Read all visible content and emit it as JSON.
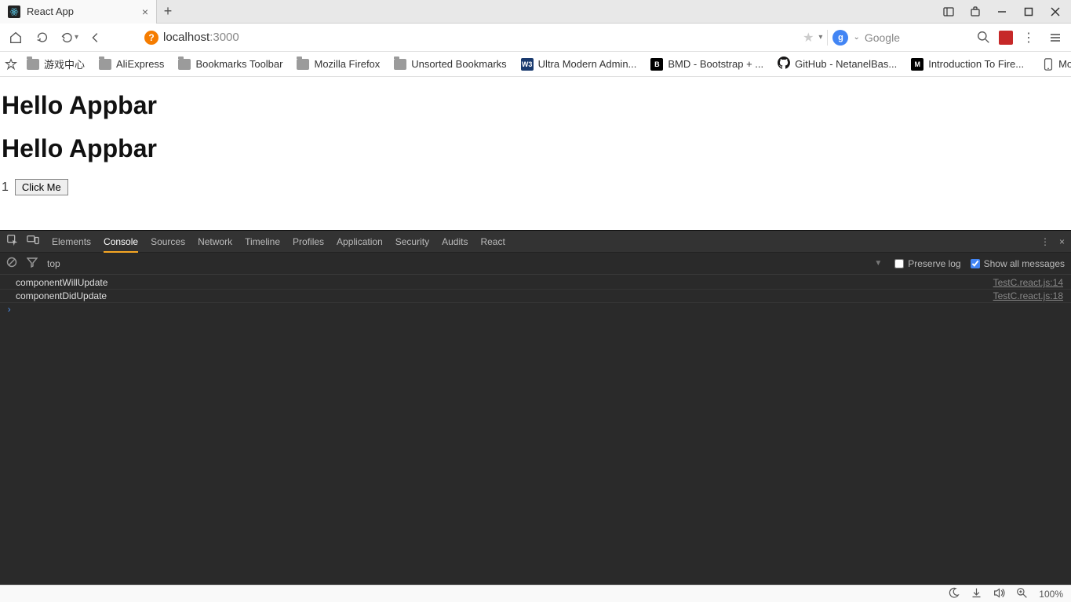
{
  "tab": {
    "title": "React App"
  },
  "address": {
    "host": "localhost",
    "port": ":3000"
  },
  "search": {
    "placeholder": "Google"
  },
  "bookmarks": [
    {
      "label": "游戏中心",
      "icon": "folder"
    },
    {
      "label": "AliExpress",
      "icon": "folder"
    },
    {
      "label": "Bookmarks Toolbar",
      "icon": "folder"
    },
    {
      "label": "Mozilla Firefox",
      "icon": "folder"
    },
    {
      "label": "Unsorted Bookmarks",
      "icon": "folder"
    },
    {
      "label": "Ultra Modern Admin...",
      "icon": "w3",
      "color": "#1a3a6e"
    },
    {
      "label": "BMD - Bootstrap + ...",
      "icon": "b",
      "color": "#000"
    },
    {
      "label": "GitHub - NetanelBas...",
      "icon": "github"
    },
    {
      "label": "Introduction To Fire...",
      "icon": "m",
      "color": "#000"
    }
  ],
  "bookmarks_right": {
    "label": "Mobile bookmarks"
  },
  "page": {
    "heading1": "Hello Appbar",
    "heading2": "Hello Appbar",
    "counter": "1",
    "button": "Click Me"
  },
  "devtools": {
    "tabs": [
      "Elements",
      "Console",
      "Sources",
      "Network",
      "Timeline",
      "Profiles",
      "Application",
      "Security",
      "Audits",
      "React"
    ],
    "active_tab": "Console",
    "toolbar": {
      "context": "top",
      "preserve": "Preserve log",
      "showall": "Show all messages"
    },
    "logs": [
      {
        "msg": "componentWillUpdate",
        "src": "TestC.react.js:14"
      },
      {
        "msg": "componentDidUpdate",
        "src": "TestC.react.js:18"
      }
    ]
  },
  "status": {
    "zoom": "100%"
  }
}
